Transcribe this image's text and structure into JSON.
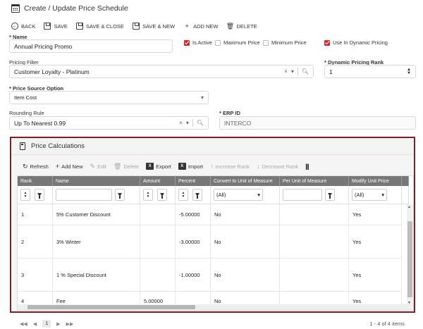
{
  "header": {
    "title": "Create / Update Price Schedule"
  },
  "toolbar": {
    "back": "BACK",
    "save": "SAVE",
    "save_close": "SAVE & CLOSE",
    "save_new": "SAVE & NEW",
    "add_new": "ADD NEW",
    "delete": "DELETE"
  },
  "form": {
    "name_label": "Name",
    "name_value": "Annual Pricing Promo",
    "is_active_label": "Is Active",
    "is_active": true,
    "maximum_price_label": "Maximum Price",
    "maximum_price": false,
    "minimum_price_label": "Minimum Price",
    "minimum_price": false,
    "use_dynamic_pricing_label": "Use In Dynamic Pricing",
    "use_dynamic_pricing": true,
    "pricing_filter_label": "Pricing Filter",
    "pricing_filter_value": "Customer Loyalty - Platinum",
    "dynamic_rank_label": "Dynamic Pricing Rank",
    "dynamic_rank_value": "1",
    "price_source_label": "Price Source Option",
    "price_source_value": "Item Cost",
    "rounding_rule_label": "Rounding Rule",
    "rounding_rule_value": "Up To Nearest 0.99",
    "erp_id_label": "ERP ID",
    "erp_id_value": "INTERCO"
  },
  "panel": {
    "title": "Price Calculations",
    "toolbar": {
      "refresh": "Refresh",
      "add_new": "Add New",
      "edit": "Edit",
      "delete": "Delete",
      "export": "Export",
      "import": "Import",
      "increase_rank": "Increase Rank",
      "decrease_rank": "Decrease Rank"
    },
    "columns": [
      "Rank",
      "Name",
      "Amount",
      "Percent",
      "Convert to Unit of Measure",
      "Per Unit of Measure",
      "Modify Unit Price"
    ],
    "filter_all": "(All)",
    "rows": [
      {
        "rank": "1",
        "name": "5% Customer Discount",
        "amount": "",
        "percent": "-5.00000",
        "convert": "No",
        "per_uom": "",
        "modify": "Yes"
      },
      {
        "rank": "2",
        "name": "3% Winter",
        "amount": "",
        "percent": "-3.00000",
        "convert": "No",
        "per_uom": "",
        "modify": "Yes"
      },
      {
        "rank": "3",
        "name": "1 % Special Discount",
        "amount": "",
        "percent": "-1.00000",
        "convert": "No",
        "per_uom": "",
        "modify": "Yes"
      },
      {
        "rank": "4",
        "name": "Fee",
        "amount": "5.00000",
        "percent": "",
        "convert": "No",
        "per_uom": "",
        "modify": "Yes"
      }
    ]
  },
  "pager": {
    "current_page": "1",
    "info": "1 - 4 of 4 items"
  },
  "colors": {
    "accent_red": "#d9262c",
    "panel_border": "#7b1f2c",
    "grid_header": "#777777"
  }
}
